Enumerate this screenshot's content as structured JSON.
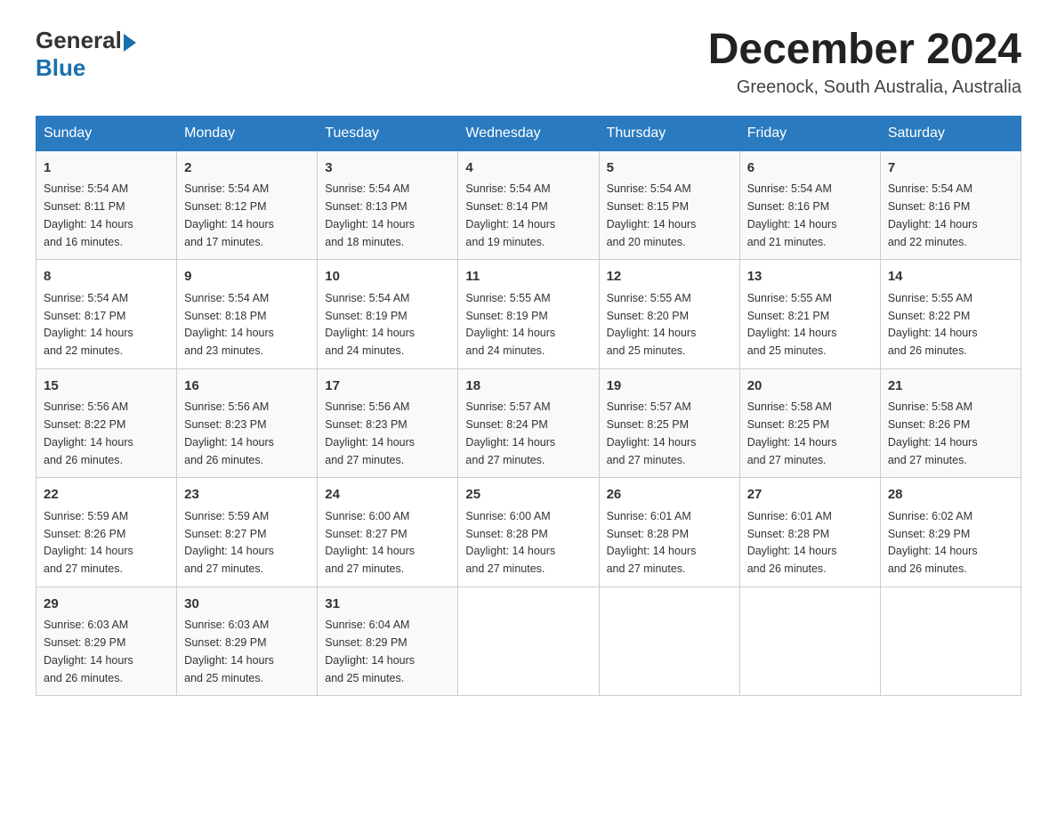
{
  "logo": {
    "general": "General",
    "blue": "Blue"
  },
  "header": {
    "title": "December 2024",
    "location": "Greenock, South Australia, Australia"
  },
  "days_of_week": [
    "Sunday",
    "Monday",
    "Tuesday",
    "Wednesday",
    "Thursday",
    "Friday",
    "Saturday"
  ],
  "weeks": [
    [
      {
        "day": "1",
        "sunrise": "5:54 AM",
        "sunset": "8:11 PM",
        "daylight": "14 hours and 16 minutes."
      },
      {
        "day": "2",
        "sunrise": "5:54 AM",
        "sunset": "8:12 PM",
        "daylight": "14 hours and 17 minutes."
      },
      {
        "day": "3",
        "sunrise": "5:54 AM",
        "sunset": "8:13 PM",
        "daylight": "14 hours and 18 minutes."
      },
      {
        "day": "4",
        "sunrise": "5:54 AM",
        "sunset": "8:14 PM",
        "daylight": "14 hours and 19 minutes."
      },
      {
        "day": "5",
        "sunrise": "5:54 AM",
        "sunset": "8:15 PM",
        "daylight": "14 hours and 20 minutes."
      },
      {
        "day": "6",
        "sunrise": "5:54 AM",
        "sunset": "8:16 PM",
        "daylight": "14 hours and 21 minutes."
      },
      {
        "day": "7",
        "sunrise": "5:54 AM",
        "sunset": "8:16 PM",
        "daylight": "14 hours and 22 minutes."
      }
    ],
    [
      {
        "day": "8",
        "sunrise": "5:54 AM",
        "sunset": "8:17 PM",
        "daylight": "14 hours and 22 minutes."
      },
      {
        "day": "9",
        "sunrise": "5:54 AM",
        "sunset": "8:18 PM",
        "daylight": "14 hours and 23 minutes."
      },
      {
        "day": "10",
        "sunrise": "5:54 AM",
        "sunset": "8:19 PM",
        "daylight": "14 hours and 24 minutes."
      },
      {
        "day": "11",
        "sunrise": "5:55 AM",
        "sunset": "8:19 PM",
        "daylight": "14 hours and 24 minutes."
      },
      {
        "day": "12",
        "sunrise": "5:55 AM",
        "sunset": "8:20 PM",
        "daylight": "14 hours and 25 minutes."
      },
      {
        "day": "13",
        "sunrise": "5:55 AM",
        "sunset": "8:21 PM",
        "daylight": "14 hours and 25 minutes."
      },
      {
        "day": "14",
        "sunrise": "5:55 AM",
        "sunset": "8:22 PM",
        "daylight": "14 hours and 26 minutes."
      }
    ],
    [
      {
        "day": "15",
        "sunrise": "5:56 AM",
        "sunset": "8:22 PM",
        "daylight": "14 hours and 26 minutes."
      },
      {
        "day": "16",
        "sunrise": "5:56 AM",
        "sunset": "8:23 PM",
        "daylight": "14 hours and 26 minutes."
      },
      {
        "day": "17",
        "sunrise": "5:56 AM",
        "sunset": "8:23 PM",
        "daylight": "14 hours and 27 minutes."
      },
      {
        "day": "18",
        "sunrise": "5:57 AM",
        "sunset": "8:24 PM",
        "daylight": "14 hours and 27 minutes."
      },
      {
        "day": "19",
        "sunrise": "5:57 AM",
        "sunset": "8:25 PM",
        "daylight": "14 hours and 27 minutes."
      },
      {
        "day": "20",
        "sunrise": "5:58 AM",
        "sunset": "8:25 PM",
        "daylight": "14 hours and 27 minutes."
      },
      {
        "day": "21",
        "sunrise": "5:58 AM",
        "sunset": "8:26 PM",
        "daylight": "14 hours and 27 minutes."
      }
    ],
    [
      {
        "day": "22",
        "sunrise": "5:59 AM",
        "sunset": "8:26 PM",
        "daylight": "14 hours and 27 minutes."
      },
      {
        "day": "23",
        "sunrise": "5:59 AM",
        "sunset": "8:27 PM",
        "daylight": "14 hours and 27 minutes."
      },
      {
        "day": "24",
        "sunrise": "6:00 AM",
        "sunset": "8:27 PM",
        "daylight": "14 hours and 27 minutes."
      },
      {
        "day": "25",
        "sunrise": "6:00 AM",
        "sunset": "8:28 PM",
        "daylight": "14 hours and 27 minutes."
      },
      {
        "day": "26",
        "sunrise": "6:01 AM",
        "sunset": "8:28 PM",
        "daylight": "14 hours and 27 minutes."
      },
      {
        "day": "27",
        "sunrise": "6:01 AM",
        "sunset": "8:28 PM",
        "daylight": "14 hours and 26 minutes."
      },
      {
        "day": "28",
        "sunrise": "6:02 AM",
        "sunset": "8:29 PM",
        "daylight": "14 hours and 26 minutes."
      }
    ],
    [
      {
        "day": "29",
        "sunrise": "6:03 AM",
        "sunset": "8:29 PM",
        "daylight": "14 hours and 26 minutes."
      },
      {
        "day": "30",
        "sunrise": "6:03 AM",
        "sunset": "8:29 PM",
        "daylight": "14 hours and 25 minutes."
      },
      {
        "day": "31",
        "sunrise": "6:04 AM",
        "sunset": "8:29 PM",
        "daylight": "14 hours and 25 minutes."
      },
      null,
      null,
      null,
      null
    ]
  ],
  "labels": {
    "sunrise": "Sunrise:",
    "sunset": "Sunset:",
    "daylight": "Daylight:"
  }
}
